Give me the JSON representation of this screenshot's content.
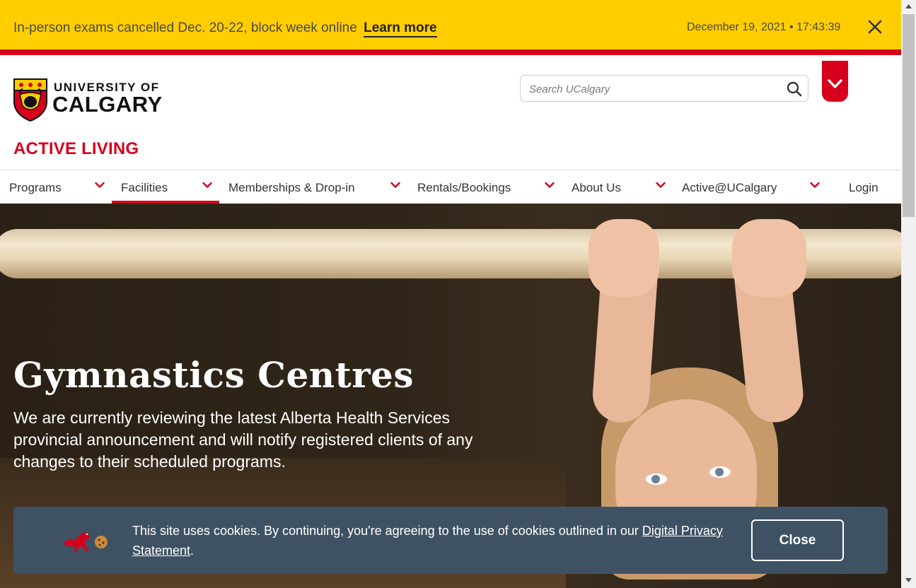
{
  "alert": {
    "message": "In-person exams cancelled Dec. 20-22, block week online",
    "link_label": "Learn more",
    "datetime": "December 19, 2021 • 17:43:39",
    "close_icon": "close-icon"
  },
  "header": {
    "logo_line1": "UNIVERSITY OF",
    "logo_line2": "CALGARY",
    "search_placeholder": "Search UCalgary",
    "site_title": "ACTIVE LIVING"
  },
  "nav": {
    "items": [
      {
        "label": "Programs"
      },
      {
        "label": "Facilities"
      },
      {
        "label": "Memberships & Drop-in"
      },
      {
        "label": "Rentals/Bookings"
      },
      {
        "label": "About Us"
      },
      {
        "label": "Active@UCalgary"
      },
      {
        "label": "Login"
      }
    ],
    "active": "Facilities"
  },
  "hero": {
    "title": "Gymnastics Centres",
    "description": "We are currently reviewing the latest Alberta Health Services provincial announcement and will notify registered clients of any changes to their scheduled programs."
  },
  "cookie": {
    "text": "This site uses cookies. By continuing, you're agreeing to the use of cookies outlined in our ",
    "link_label": "Digital Privacy Statement",
    "suffix": ".",
    "close_label": "Close"
  },
  "colors": {
    "brand_red": "#d6001c",
    "alert_yellow": "#ffcd00",
    "cookie_bg": "#3f5263"
  }
}
